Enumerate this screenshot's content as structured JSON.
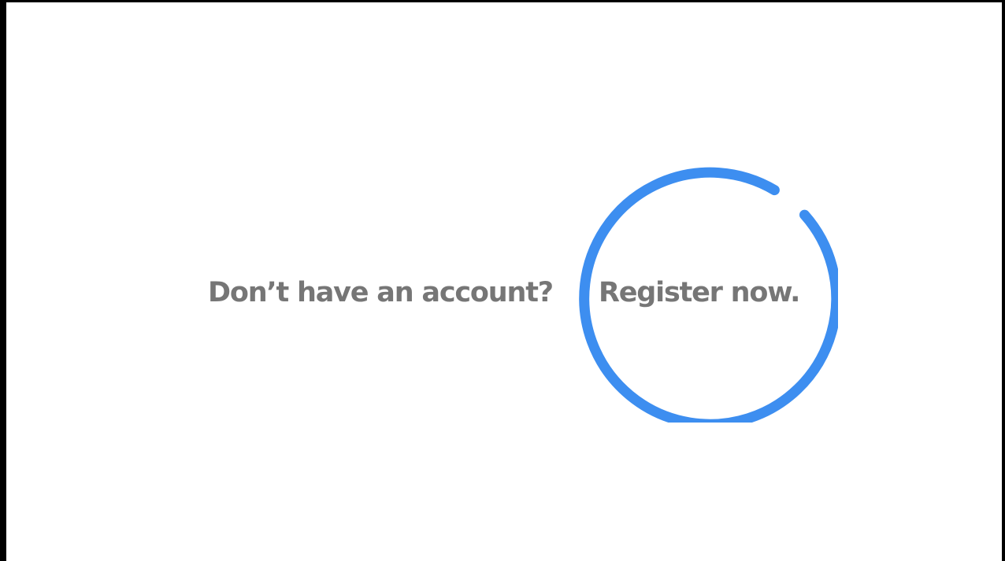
{
  "prompt": {
    "question_text": "Don’t have an account?",
    "register_link_text": "Register now."
  },
  "highlight": {
    "color": "#3d8ef0"
  }
}
